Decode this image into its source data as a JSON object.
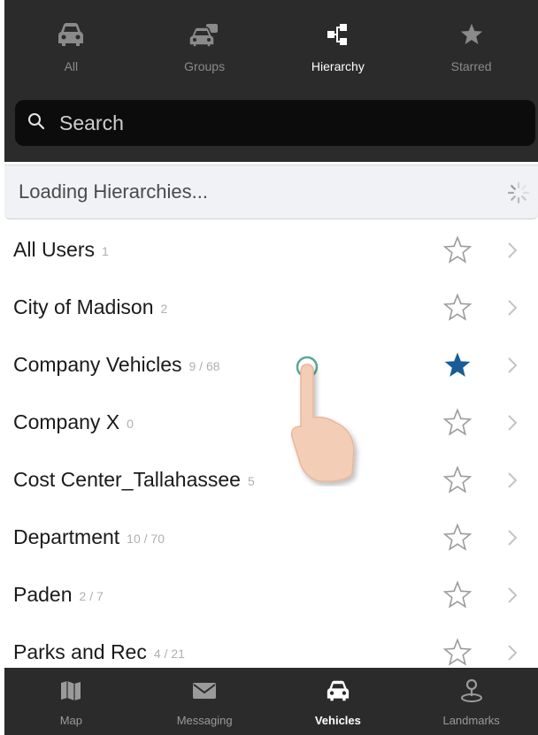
{
  "colors": {
    "bar_bg": "#2b2b2b",
    "search_bg": "#0c0c0c",
    "active": "#ffffff",
    "inactive": "#8a8a8a",
    "star_filled": "#1a5c96",
    "count_text": "#b0b0b0"
  },
  "top_tabs": [
    {
      "label": "All",
      "icon": "car-icon",
      "active": false
    },
    {
      "label": "Groups",
      "icon": "group-vehicles-icon",
      "active": false
    },
    {
      "label": "Hierarchy",
      "icon": "hierarchy-icon",
      "active": true
    },
    {
      "label": "Starred",
      "icon": "star-icon",
      "active": false
    }
  ],
  "search": {
    "placeholder": "Search",
    "value": ""
  },
  "loading": {
    "text": "Loading Hierarchies..."
  },
  "rows": [
    {
      "name": "All Users",
      "count": "1",
      "starred": false
    },
    {
      "name": "City of Madison",
      "count": "2",
      "starred": false
    },
    {
      "name": "Company Vehicles",
      "count": "9 / 68",
      "starred": true
    },
    {
      "name": "Company X",
      "count": "0",
      "starred": false
    },
    {
      "name": "Cost Center_Tallahassee",
      "count": "5",
      "starred": false
    },
    {
      "name": "Department",
      "count": "10 / 70",
      "starred": false
    },
    {
      "name": "Paden",
      "count": "2 / 7",
      "starred": false
    },
    {
      "name": "Parks and Rec",
      "count": "4 / 21",
      "starred": false
    }
  ],
  "bottom_tabs": [
    {
      "label": "Map",
      "icon": "map-icon",
      "active": false
    },
    {
      "label": "Messaging",
      "icon": "envelope-icon",
      "active": false
    },
    {
      "label": "Vehicles",
      "icon": "car-icon",
      "active": true
    },
    {
      "label": "Landmarks",
      "icon": "landmark-pin-icon",
      "active": false
    }
  ]
}
